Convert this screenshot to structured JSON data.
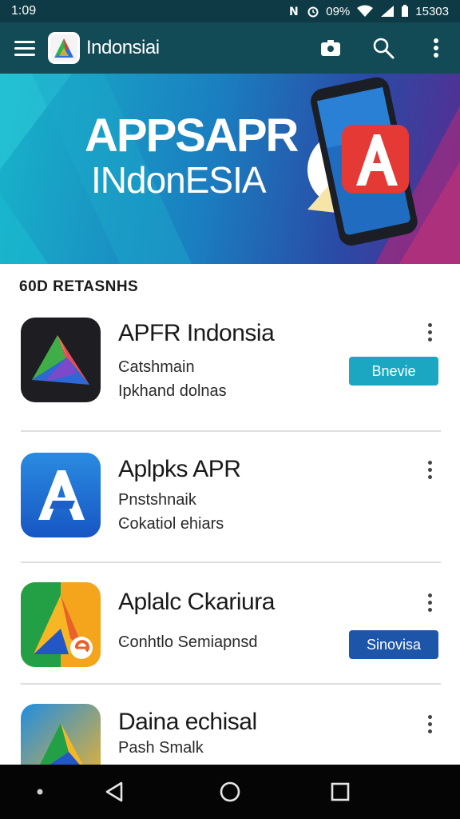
{
  "status_bar": {
    "time": "1:09",
    "battery": "09%",
    "clock_right": "15303",
    "icons": [
      "nfc-icon",
      "alarm-icon",
      "wifi-icon",
      "signal-icon",
      "battery-icon"
    ]
  },
  "app_bar": {
    "title": "Indonsiai",
    "icons": [
      "menu-icon",
      "camera-icon",
      "search-icon",
      "more-vertical-icon"
    ]
  },
  "banner": {
    "title": "APPSAPR",
    "subtitle": "INdonESIA"
  },
  "section": {
    "title": "60D RETASNHS"
  },
  "apps": [
    {
      "name": "APFR Indonsia",
      "line1": "Ͼatshmain",
      "line2": "Ipkhand dolnas",
      "button": "Bnevie",
      "button_color": "#1ba7c2"
    },
    {
      "name": "Aplpks APR",
      "line1": "Pnstshnaik",
      "line2": "Ͼokatiol ehiars",
      "button": "",
      "button_color": ""
    },
    {
      "name": "Aplalc Ckariura",
      "line1": "Ͼonhtlo Semiapnsd",
      "line2": "",
      "button": "Sinovisa",
      "button_color": "#1d55a8"
    },
    {
      "name": "Daina echisal",
      "line1": "Pash Smalk",
      "line2": "",
      "button": "",
      "button_color": ""
    }
  ],
  "colors": {
    "status_bar": "#0d3a44",
    "app_bar": "#124a55",
    "nav_bar": "#050505"
  },
  "nav": {
    "icons": [
      "dot-icon",
      "back-icon",
      "home-icon",
      "recents-icon"
    ]
  }
}
